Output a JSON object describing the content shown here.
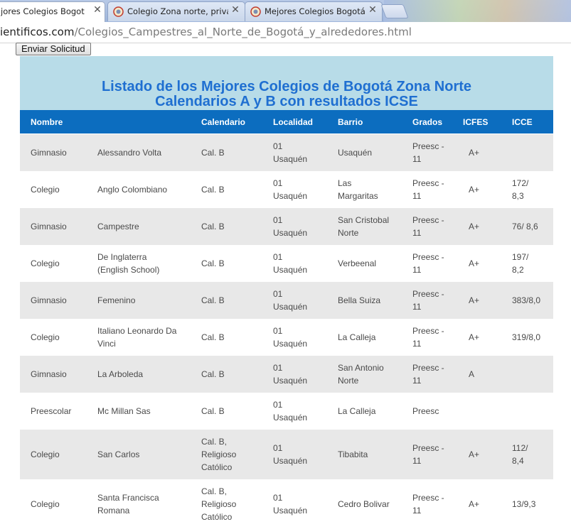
{
  "browser": {
    "tabs": [
      {
        "title": "jores Colegios Bogotá",
        "active": true
      },
      {
        "title": "Colegio Zona norte, privad",
        "active": false
      },
      {
        "title": "Mejores Colegios Bogotá",
        "active": false
      }
    ],
    "url_host": "ientificos.com",
    "url_path": "/Colegios_Campestres_al_Norte_de_Bogotá_y_alrededores.html"
  },
  "page": {
    "send_button": "Enviar Solicitud",
    "title_line1": "Listado de los Mejores Colegios de Bogotá Zona Norte",
    "title_line2": "Calendarios A y B con resultados ICSE"
  },
  "table": {
    "headers": {
      "nombre": "Nombre",
      "calendario": "Calendario",
      "localidad": "Localidad",
      "barrio": "Barrio",
      "grados": "Grados",
      "icfes": "ICFES",
      "icce": "ICCE"
    },
    "rows": [
      {
        "tipo": "Gimnasio",
        "nombre": [
          "Alessandro Volta"
        ],
        "calendario": [
          "Cal. B"
        ],
        "localidad": [
          "01",
          "Usaquén"
        ],
        "barrio": [
          "Usaquén"
        ],
        "grados": [
          "Preesc -",
          "11"
        ],
        "icfes": "A+",
        "icce": []
      },
      {
        "tipo": "Colegio",
        "nombre": [
          "Anglo Colombiano"
        ],
        "calendario": [
          "Cal. B"
        ],
        "localidad": [
          "01",
          "Usaquén"
        ],
        "barrio": [
          "Las",
          "Margaritas"
        ],
        "grados": [
          "Preesc -",
          "11"
        ],
        "icfes": "A+",
        "icce": [
          "172/",
          "8,3"
        ]
      },
      {
        "tipo": "Gimnasio",
        "nombre": [
          "Campestre"
        ],
        "calendario": [
          "Cal. B"
        ],
        "localidad": [
          "01",
          "Usaquén"
        ],
        "barrio": [
          "San Cristobal",
          "Norte"
        ],
        "grados": [
          "Preesc -",
          "11"
        ],
        "icfes": "A+",
        "icce": [
          "76/ 8,6"
        ]
      },
      {
        "tipo": "Colegio",
        "nombre": [
          "De Inglaterra",
          "(English School)"
        ],
        "calendario": [
          "Cal. B"
        ],
        "localidad": [
          "01",
          "Usaquén"
        ],
        "barrio": [
          "Verbeenal"
        ],
        "grados": [
          "Preesc -",
          "11"
        ],
        "icfes": "A+",
        "icce": [
          "197/",
          "8,2"
        ]
      },
      {
        "tipo": "Gimnasio",
        "nombre": [
          "Femenino"
        ],
        "calendario": [
          "Cal. B"
        ],
        "localidad": [
          "01",
          "Usaquén"
        ],
        "barrio": [
          "Bella Suiza"
        ],
        "grados": [
          "Preesc -",
          "11"
        ],
        "icfes": "A+",
        "icce": [
          "383/8,0"
        ]
      },
      {
        "tipo": "Colegio",
        "nombre": [
          "Italiano Leonardo Da",
          "Vinci"
        ],
        "calendario": [
          "Cal. B"
        ],
        "localidad": [
          "01",
          "Usaquén"
        ],
        "barrio": [
          "La Calleja"
        ],
        "grados": [
          "Preesc -",
          "11"
        ],
        "icfes": "A+",
        "icce": [
          "319/8,0"
        ]
      },
      {
        "tipo": "Gimnasio",
        "nombre": [
          "La Arboleda"
        ],
        "calendario": [
          "Cal. B"
        ],
        "localidad": [
          "01",
          "Usaquén"
        ],
        "barrio": [
          "San Antonio",
          "Norte"
        ],
        "grados": [
          "Preesc -",
          "11"
        ],
        "icfes": "A",
        "icce": []
      },
      {
        "tipo": "Preescolar",
        "nombre": [
          "Mc Millan Sas"
        ],
        "calendario": [
          "Cal. B"
        ],
        "localidad": [
          "01",
          "Usaquén"
        ],
        "barrio": [
          "La Calleja"
        ],
        "grados": [
          "Preesc"
        ],
        "icfes": "",
        "icce": []
      },
      {
        "tipo": "Colegio",
        "nombre": [
          "San Carlos"
        ],
        "calendario": [
          "Cal. B,",
          "Religioso",
          "Católico"
        ],
        "localidad": [
          "01",
          "Usaquén"
        ],
        "barrio": [
          "Tibabita"
        ],
        "grados": [
          "Preesc -",
          "11"
        ],
        "icfes": "A+",
        "icce": [
          "112/",
          "8,4"
        ]
      },
      {
        "tipo": "Colegio",
        "nombre": [
          "Santa Francisca",
          "Romana"
        ],
        "calendario": [
          "Cal. B,",
          "Religioso",
          "Católico"
        ],
        "localidad": [
          "01",
          "Usaquén"
        ],
        "barrio": [
          "Cedro Bolivar"
        ],
        "grados": [
          "Preesc -",
          "11"
        ],
        "icfes": "A+",
        "icce": [
          "13/9,3"
        ]
      }
    ]
  },
  "colors": {
    "header_bg": "#0c6dbf",
    "title_box_bg": "#b8dce8",
    "title_text": "#1f6fd1",
    "row_shade": "#e8e8e8"
  }
}
